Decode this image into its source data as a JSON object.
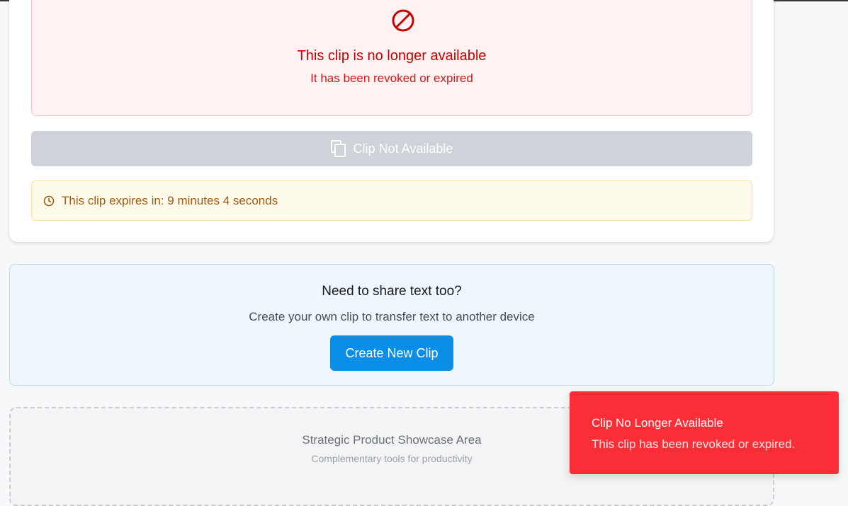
{
  "error": {
    "icon": "ban-icon",
    "title": "This clip is no longer available",
    "subtitle": "It has been revoked or expired"
  },
  "copy_button": {
    "icon": "copy-icon",
    "label": "Clip Not Available"
  },
  "expiry": {
    "icon": "clock-icon",
    "text": "This clip expires in: 9 minutes 4 seconds"
  },
  "share": {
    "title": "Need to share text too?",
    "subtitle": "Create your own clip to transfer text to another device",
    "button_label": "Create New Clip"
  },
  "showcase": {
    "title": "Strategic Product Showcase Area",
    "subtitle": "Complementary tools for productivity"
  },
  "toast": {
    "title": "Clip No Longer Available",
    "message": "This clip has been revoked or expired."
  },
  "colors": {
    "error_red": "#cc0000",
    "toast_red": "#fb2d36",
    "primary_blue": "#0a8ee8",
    "warning_brown": "#a35a14"
  }
}
